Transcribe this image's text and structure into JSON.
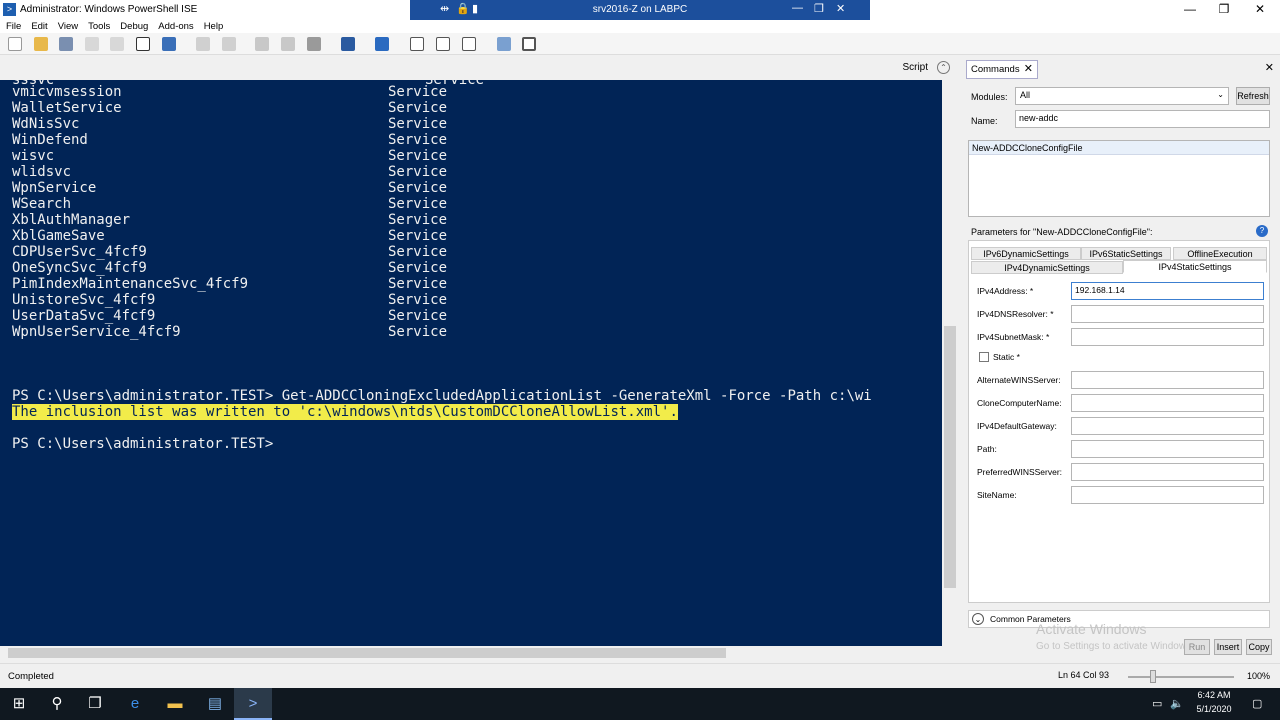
{
  "window": {
    "title": "Administrator: Windows PowerShell ISE",
    "rdp_title": "srv2016-Z on LABPC",
    "minimize": "—",
    "maximize": "❐",
    "close": "✕"
  },
  "menu": [
    "File",
    "Edit",
    "View",
    "Tools",
    "Debug",
    "Add-ons",
    "Help"
  ],
  "script_pane": {
    "label": "Script",
    "collapse_glyph": "⌃"
  },
  "console": {
    "partial_top": "sssvc                                            Service",
    "services": [
      {
        "name": "vmicvmsession",
        "type": "Service"
      },
      {
        "name": "WalletService",
        "type": "Service"
      },
      {
        "name": "WdNisSvc",
        "type": "Service"
      },
      {
        "name": "WinDefend",
        "type": "Service"
      },
      {
        "name": "wisvc",
        "type": "Service"
      },
      {
        "name": "wlidsvc",
        "type": "Service"
      },
      {
        "name": "WpnService",
        "type": "Service"
      },
      {
        "name": "WSearch",
        "type": "Service"
      },
      {
        "name": "XblAuthManager",
        "type": "Service"
      },
      {
        "name": "XblGameSave",
        "type": "Service"
      },
      {
        "name": "CDPUserSvc_4fcf9",
        "type": "Service"
      },
      {
        "name": "OneSyncSvc_4fcf9",
        "type": "Service"
      },
      {
        "name": "PimIndexMaintenanceSvc_4fcf9",
        "type": "Service"
      },
      {
        "name": "UnistoreSvc_4fcf9",
        "type": "Service"
      },
      {
        "name": "UserDataSvc_4fcf9",
        "type": "Service"
      },
      {
        "name": "WpnUserService_4fcf9",
        "type": "Service"
      }
    ],
    "command_line": "PS C:\\Users\\administrator.TEST> Get-ADDCCloningExcludedApplicationList -GenerateXml -Force -Path c:\\wi",
    "output_line": "The inclusion list was written to 'c:\\windows\\ntds\\CustomDCCloneAllowList.xml'.",
    "prompt": "PS C:\\Users\\administrator.TEST>"
  },
  "commands": {
    "tab_label": "Commands",
    "modules_label": "Modules:",
    "modules_value": "All",
    "refresh_label": "Refresh",
    "name_label": "Name:",
    "name_value": "new-addc",
    "results": [
      "New-ADDCCloneConfigFile"
    ],
    "params_for": "Parameters for \"New-ADDCCloneConfigFile\":",
    "tabs_row1": [
      "IPv6DynamicSettings",
      "IPv6StaticSettings",
      "OfflineExecution"
    ],
    "tabs_row2": [
      "IPv4DynamicSettings",
      "IPv4StaticSettings"
    ],
    "params": [
      {
        "label": "IPv4Address: *",
        "value": "192.168.1.14"
      },
      {
        "label": "IPv4DNSResolver: *",
        "value": ""
      },
      {
        "label": "IPv4SubnetMask: *",
        "value": ""
      }
    ],
    "static_label": "Static *",
    "params2": [
      {
        "label": "AlternateWINSServer:",
        "value": ""
      },
      {
        "label": "CloneComputerName:",
        "value": ""
      },
      {
        "label": "IPv4DefaultGateway:",
        "value": ""
      },
      {
        "label": "Path:",
        "value": ""
      },
      {
        "label": "PreferredWINSServer:",
        "value": ""
      },
      {
        "label": "SiteName:",
        "value": ""
      }
    ],
    "common_params": "Common Parameters",
    "activate_title": "Activate Windows",
    "activate_sub": "Go to Settings to activate Windows.",
    "run_label": "Run",
    "insert_label": "Insert",
    "copy_label": "Copy"
  },
  "status": {
    "text": "Completed",
    "position": "Ln 64  Col 93",
    "zoom": "100%"
  },
  "taskbar": {
    "time": "6:42 AM",
    "date": "5/1/2020"
  },
  "colors": {
    "console_bg": "#012456",
    "highlight": "#f2ec4a",
    "rdp_bar": "#1c4f9c"
  }
}
